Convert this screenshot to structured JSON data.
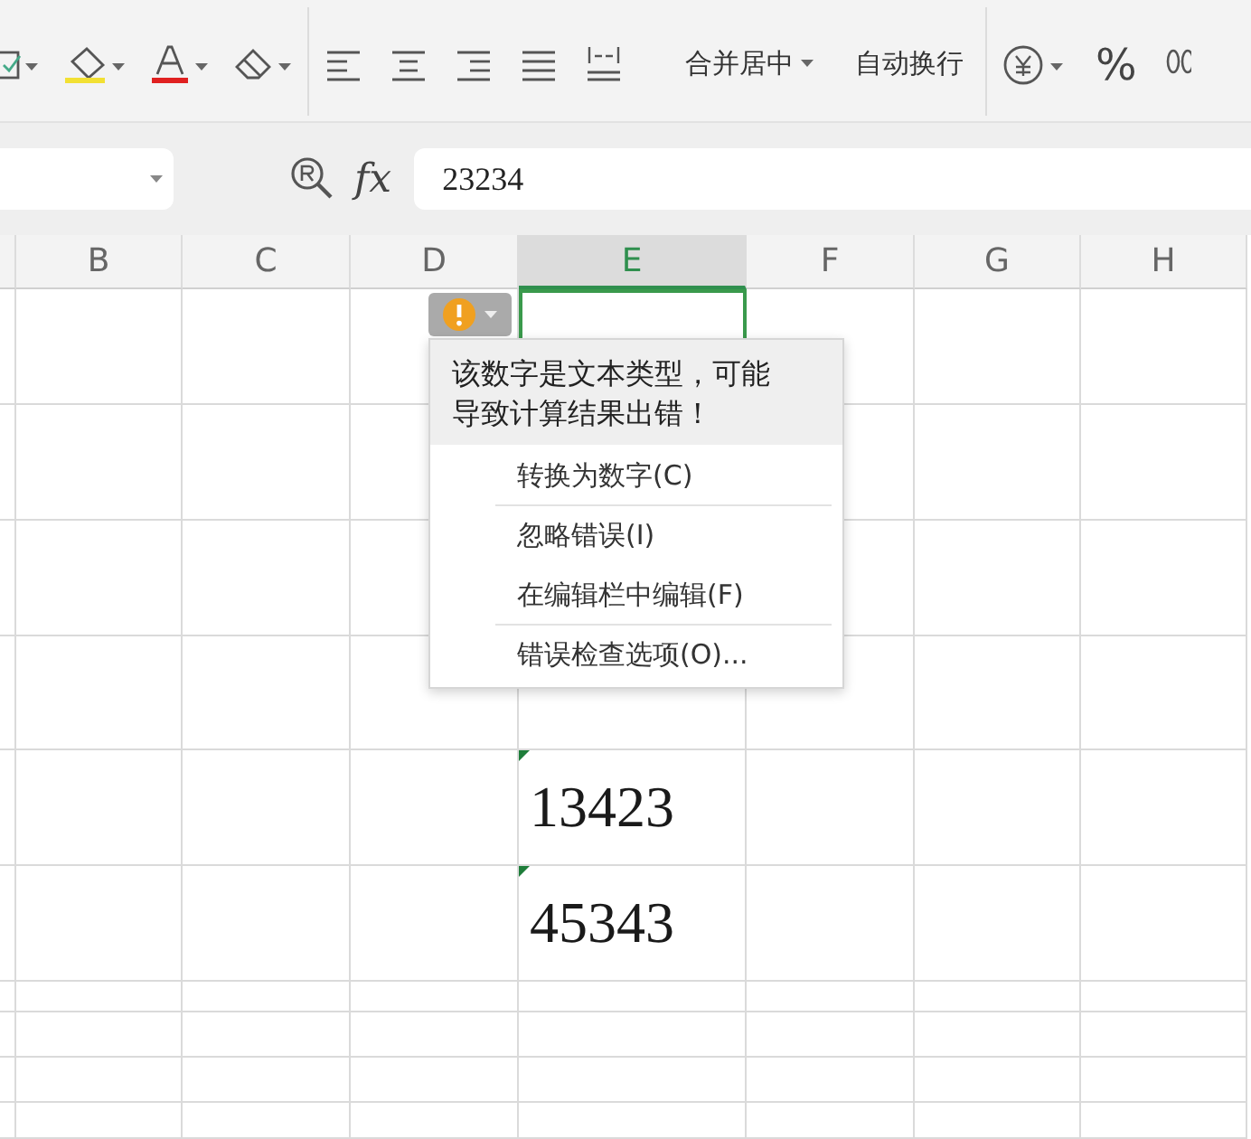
{
  "ribbon": {
    "merge_label": "合并居中",
    "wrap_label": "自动换行",
    "percent": "%"
  },
  "formula_bar": {
    "fx": "fx",
    "value": "23234"
  },
  "columns": [
    {
      "label": "B",
      "selected": false
    },
    {
      "label": "C",
      "selected": false
    },
    {
      "label": "D",
      "selected": false
    },
    {
      "label": "E",
      "selected": true
    },
    {
      "label": "F",
      "selected": false
    },
    {
      "label": "G",
      "selected": false
    },
    {
      "label": "H",
      "selected": false
    }
  ],
  "column_e": [
    {
      "selected": true,
      "flagged": false
    },
    {
      "selected": false,
      "flagged": false
    },
    {
      "value": "13423",
      "selected": false,
      "flagged": true
    },
    {
      "value": "45343",
      "selected": false,
      "flagged": true
    }
  ],
  "error_menu": {
    "message": "该数字是文本类型，可能导致计算结果出错！",
    "items": [
      {
        "label": "转换为数字(C)",
        "separator_before": false
      },
      {
        "label": "忽略错误(I)",
        "separator_before": true
      },
      {
        "label": "在编辑栏中编辑(F)",
        "separator_before": false
      },
      {
        "label": "错误检查选项(O)...",
        "separator_before": true
      }
    ]
  }
}
